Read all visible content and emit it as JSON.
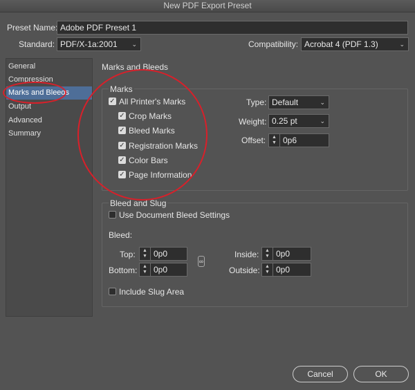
{
  "window": {
    "title": "New PDF Export Preset"
  },
  "header": {
    "preset_name_label": "Preset Name:",
    "preset_name_value": "Adobe PDF Preset 1",
    "standard_label": "Standard:",
    "standard_value": "PDF/X-1a:2001",
    "compatibility_label": "Compatibility:",
    "compatibility_value": "Acrobat 4 (PDF 1.3)"
  },
  "sidebar": {
    "items": [
      {
        "label": "General"
      },
      {
        "label": "Compression"
      },
      {
        "label": "Marks and Bleeds"
      },
      {
        "label": "Output"
      },
      {
        "label": "Advanced"
      },
      {
        "label": "Summary"
      }
    ],
    "active": "Marks and Bleeds"
  },
  "main": {
    "section_title": "Marks and Bleeds",
    "marks": {
      "group_title": "Marks",
      "all_printers_marks": {
        "label": "All Printer's Marks",
        "checked": true
      },
      "crop_marks": {
        "label": "Crop Marks",
        "checked": true
      },
      "bleed_marks": {
        "label": "Bleed Marks",
        "checked": true
      },
      "registration_marks": {
        "label": "Registration Marks",
        "checked": true
      },
      "color_bars": {
        "label": "Color Bars",
        "checked": true
      },
      "page_information": {
        "label": "Page Information",
        "checked": true
      },
      "type_label": "Type:",
      "type_value": "Default",
      "weight_label": "Weight:",
      "weight_value": "0.25 pt",
      "offset_label": "Offset:",
      "offset_value": "0p6"
    },
    "bleed": {
      "group_title": "Bleed and Slug",
      "use_document_bleed": {
        "label": "Use Document Bleed Settings",
        "checked": false
      },
      "bleed_label": "Bleed:",
      "top_label": "Top:",
      "top_value": "0p0",
      "bottom_label": "Bottom:",
      "bottom_value": "0p0",
      "inside_label": "Inside:",
      "inside_value": "0p0",
      "outside_label": "Outside:",
      "outside_value": "0p0",
      "include_slug": {
        "label": "Include Slug Area",
        "checked": false
      }
    }
  },
  "footer": {
    "cancel_label": "Cancel",
    "ok_label": "OK"
  },
  "annotation_color": "#d8202a"
}
